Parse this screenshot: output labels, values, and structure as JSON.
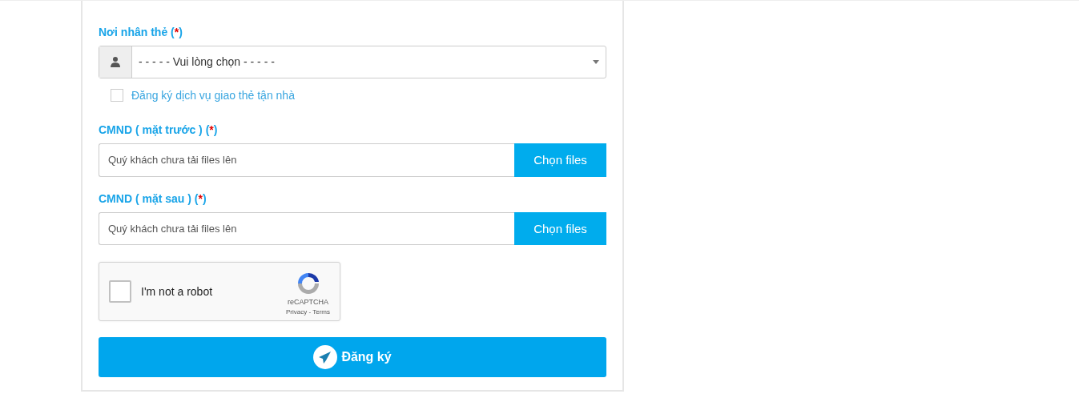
{
  "recipient": {
    "label": [
      {
        "text": "Nơi nhân thẻ (",
        "kind": "text"
      },
      {
        "text": "*",
        "kind": "required"
      },
      {
        "text": ")",
        "kind": "text"
      }
    ],
    "select_value": "- - - - - Vui lòng chọn - - - - -",
    "delivery": {
      "label": "Đăng ký dịch vụ giao thẻ tận nhà",
      "checked": false
    }
  },
  "uploads": [
    {
      "label": [
        {
          "text": "CMND ( mặt trước ) (",
          "kind": "text"
        },
        {
          "text": "*",
          "kind": "required"
        },
        {
          "text": ")",
          "kind": "text"
        }
      ],
      "placeholder": "Quý khách chưa tải files lên",
      "button": "Chọn files"
    },
    {
      "label": [
        {
          "text": "CMND ( mặt sau ) (",
          "kind": "text"
        },
        {
          "text": "*",
          "kind": "required"
        },
        {
          "text": ")",
          "kind": "text"
        }
      ],
      "placeholder": "Quý khách chưa tải files lên",
      "button": "Chọn files"
    }
  ],
  "captcha": {
    "label": "I'm not a robot",
    "checked": false,
    "brand": "reCAPTCHA",
    "links": "Privacy - Terms"
  },
  "submit": "Đăng ký"
}
